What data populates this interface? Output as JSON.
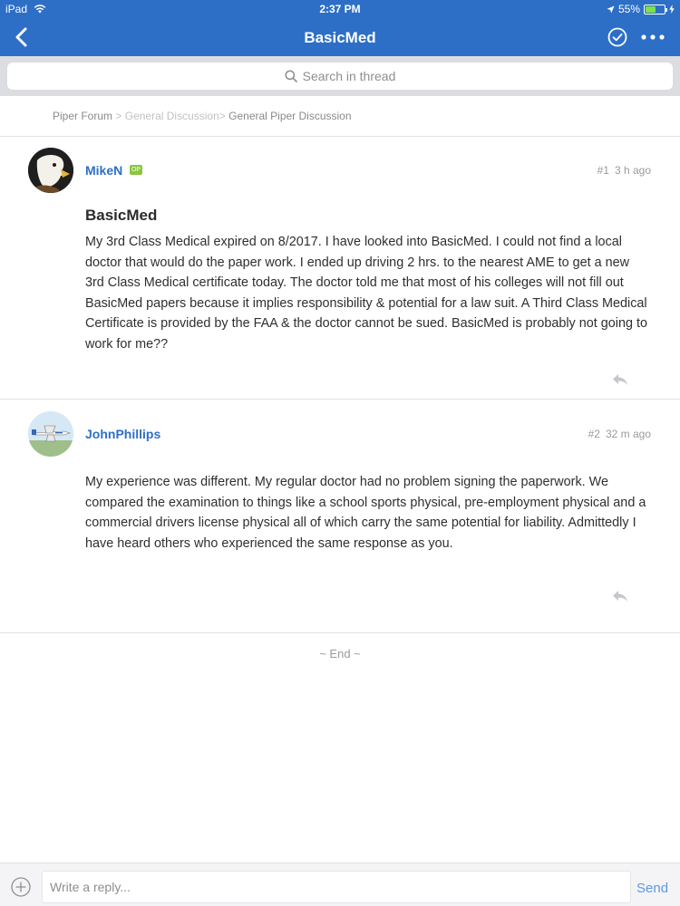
{
  "status_bar": {
    "device": "iPad",
    "time": "2:37 PM",
    "battery_percent": "55%",
    "battery_level": 0.55
  },
  "nav": {
    "title": "BasicMed",
    "back_icon": "chevron-left-icon",
    "check_icon": "check-circle-icon",
    "more_icon": "more-horizontal-icon"
  },
  "search": {
    "placeholder": "Search in thread"
  },
  "breadcrumb": {
    "items": [
      "Piper Forum",
      "General Discussion",
      "General Piper Discussion"
    ],
    "separator": ">"
  },
  "posts": [
    {
      "author": "MikeN",
      "badge": "OP",
      "number": "#1",
      "time": "3 h ago",
      "title": "BasicMed",
      "body": "My 3rd Class Medical expired on 8/2017. I have looked into BasicMed. I could not find a local doctor that would do the paper work. I ended up driving 2 hrs. to the nearest AME to get a new 3rd Class Medical certificate today. The doctor told me that most of his colleges will not fill out BasicMed papers because it implies responsibility & potential for a law suit. A Third Class Medical Certificate is provided by the FAA & the doctor cannot be sued. BasicMed is probably not going to work for me??"
    },
    {
      "author": "JohnPhillips",
      "number": "#2",
      "time": "32 m ago",
      "body": "My experience was different. My regular doctor had no problem signing the paperwork. We compared the examination to things like a school sports physical, pre-employment physical and a commercial drivers license physical all of which carry the same potential for liability. Admittedly I have heard others who experienced the same response as you."
    }
  ],
  "end_label": "~ End ~",
  "composer": {
    "placeholder": "Write a reply...",
    "send_label": "Send"
  },
  "colors": {
    "header": "#2d6fc7",
    "link": "#2d6fc7",
    "op_badge": "#8ac540",
    "send": "#5b9be0"
  }
}
